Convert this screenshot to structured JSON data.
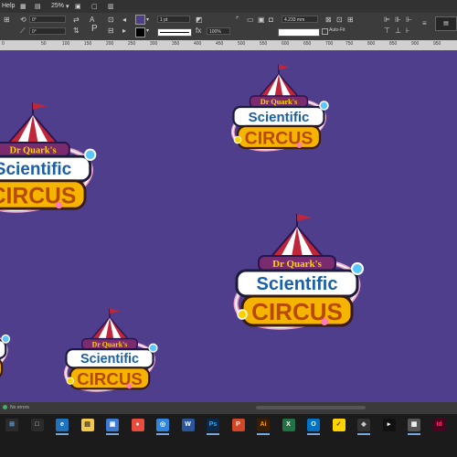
{
  "menubar": {
    "help_label": "Help",
    "zoom": "25%"
  },
  "control_panel": {
    "x_field": "0°",
    "y_field": "0°",
    "stroke_weight": "1 pt",
    "scale_pct": "100%",
    "width_field": "4.233 mm",
    "autofit_label": "Auto-Fit"
  },
  "ruler": {
    "ticks": [
      "0",
      "50",
      "100",
      "150",
      "200",
      "250",
      "300",
      "350",
      "400",
      "450",
      "500",
      "550",
      "600",
      "650",
      "700",
      "750",
      "800",
      "850",
      "900",
      "950",
      "1000",
      "1050",
      "1100",
      "1150",
      "1200",
      "1250"
    ]
  },
  "artwork": {
    "line1": "Dr Quark's",
    "line2": "Scientific",
    "line3": "CIRCUS"
  },
  "status": {
    "preflight": "No errors"
  },
  "taskbar": {
    "icons": [
      {
        "label": "⊞",
        "color": "#2b2b2b",
        "fg": "#4aa3ff"
      },
      {
        "label": "□",
        "color": "#2b2b2b",
        "fg": "#ddd"
      },
      {
        "label": "e",
        "color": "#1e73be",
        "fg": "#fff"
      },
      {
        "label": "▤",
        "color": "#f2c94c",
        "fg": "#333"
      },
      {
        "label": "▣",
        "color": "#3a7bd5",
        "fg": "#fff"
      },
      {
        "label": "●",
        "color": "#e74c3c",
        "fg": "#fff"
      },
      {
        "label": "◎",
        "color": "#2e86de",
        "fg": "#fff"
      },
      {
        "label": "W",
        "color": "#2b579a",
        "fg": "#fff"
      },
      {
        "label": "Ps",
        "color": "#0b2a4a",
        "fg": "#31a8ff"
      },
      {
        "label": "P",
        "color": "#d24726",
        "fg": "#fff"
      },
      {
        "label": "Ai",
        "color": "#3a1e00",
        "fg": "#ff9a00"
      },
      {
        "label": "X",
        "color": "#217346",
        "fg": "#fff"
      },
      {
        "label": "O",
        "color": "#0072c6",
        "fg": "#fff"
      },
      {
        "label": "✓",
        "color": "#ffd200",
        "fg": "#333"
      },
      {
        "label": "◆",
        "color": "#333",
        "fg": "#ccc"
      },
      {
        "label": "▸",
        "color": "#111",
        "fg": "#fff"
      },
      {
        "label": "▦",
        "color": "#555",
        "fg": "#fff"
      },
      {
        "label": "Id",
        "color": "#49021f",
        "fg": "#ff3366"
      }
    ]
  },
  "colors": {
    "canvas": "#4e3e8c",
    "tent_red": "#c0263a",
    "circus_yellow": "#f5b400",
    "science_blue": "#cfeeff",
    "outline": "#2a1450"
  }
}
